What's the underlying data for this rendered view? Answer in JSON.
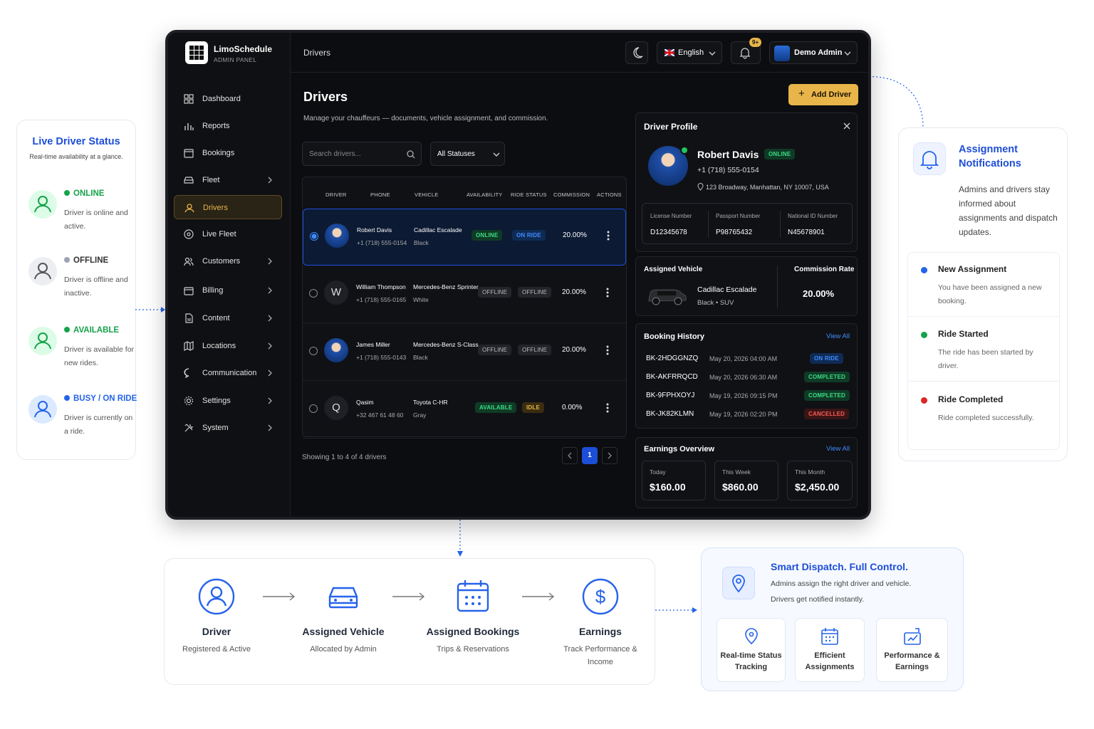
{
  "live_status": {
    "title": "Live Driver Status",
    "subtitle": "Real-time availability at a glance.",
    "items": [
      {
        "label": "ONLINE",
        "desc": "Driver is online and active.",
        "color": "#16a34a"
      },
      {
        "label": "OFFLINE",
        "desc": "Driver is offline and inactive.",
        "color": "#9ca3af"
      },
      {
        "label": "AVAILABLE",
        "desc": "Driver is available for new rides.",
        "color": "#16a34a"
      },
      {
        "label": "BUSY / ON RIDE",
        "desc": "Driver is currently on a ride.",
        "color": "#2563eb"
      }
    ]
  },
  "app": {
    "name": "LimoSchedule",
    "subtitle": "ADMIN PANEL",
    "breadcrumb": "Drivers",
    "language": "English",
    "notif_badge": "9+",
    "user": "Demo Admin"
  },
  "sidebar": {
    "items": [
      {
        "label": "Dashboard",
        "icon": "dashboard-icon"
      },
      {
        "label": "Reports",
        "icon": "reports-icon"
      },
      {
        "label": "Bookings",
        "icon": "calendar-icon"
      },
      {
        "label": "Fleet",
        "icon": "car-icon"
      },
      {
        "label": "Drivers",
        "icon": "driver-icon"
      },
      {
        "label": "Live Fleet",
        "icon": "location-icon"
      },
      {
        "label": "Customers",
        "icon": "users-icon"
      },
      {
        "label": "Billing",
        "icon": "wallet-icon"
      },
      {
        "label": "Content",
        "icon": "document-icon"
      },
      {
        "label": "Locations",
        "icon": "map-icon"
      },
      {
        "label": "Communication",
        "icon": "chat-icon"
      },
      {
        "label": "Settings",
        "icon": "gear-icon"
      },
      {
        "label": "System",
        "icon": "tools-icon"
      }
    ]
  },
  "page": {
    "title": "Drivers",
    "description": "Manage your chauffeurs — documents, vehicle assignment, and commission.",
    "add_button": "Add Driver",
    "search_placeholder": "Search drivers...",
    "status_filter": "All Statuses",
    "showing": "Showing 1 to 4 of 4 drivers",
    "current_page": "1"
  },
  "table": {
    "headers": [
      "DRIVER",
      "PHONE",
      "VEHICLE",
      "AVAILABILITY",
      "RIDE STATUS",
      "COMMISSION",
      "ACTIONS"
    ],
    "rows": [
      {
        "name": "Robert Davis",
        "phone": "+1 (718) 555-0154",
        "vehicle": "Cadillac Escalade",
        "color": "Black",
        "availability": "ONLINE",
        "ride_status": "ON RIDE",
        "commission": "20.00%",
        "initial": ""
      },
      {
        "name": "William Thompson",
        "phone": "+1 (718) 555-0165",
        "vehicle": "Mercedes-Benz Sprinter",
        "color": "White",
        "availability": "OFFLINE",
        "ride_status": "OFFLINE",
        "commission": "20.00%",
        "initial": "W"
      },
      {
        "name": "James Miller",
        "phone": "+1 (718) 555-0143",
        "vehicle": "Mercedes-Benz S-Class",
        "color": "Black",
        "availability": "OFFLINE",
        "ride_status": "OFFLINE",
        "commission": "20.00%",
        "initial": ""
      },
      {
        "name": "Qasim",
        "phone": "+32 467 61 48 60",
        "vehicle": "Toyota C-HR",
        "color": "Gray",
        "availability": "AVAILABLE",
        "ride_status": "IDLE",
        "commission": "0.00%",
        "initial": "Q"
      }
    ]
  },
  "profile": {
    "title": "Driver Profile",
    "name": "Robert Davis",
    "status": "ONLINE",
    "phone": "+1 (718) 555-0154",
    "address": "123 Broadway, Manhattan, NY 10007, USA",
    "docs": [
      {
        "label": "License Number",
        "value": "D12345678"
      },
      {
        "label": "Passport Number",
        "value": "P98765432"
      },
      {
        "label": "National ID Number",
        "value": "N45678901"
      }
    ],
    "vehicle_label": "Assigned Vehicle",
    "vehicle_name": "Cadillac Escalade",
    "vehicle_desc": "Black • SUV",
    "commission_label": "Commission Rate",
    "commission_value": "20.00%",
    "history_title": "Booking History",
    "view_all": "View All",
    "history": [
      {
        "id": "BK-2HDGGNZQ",
        "date": "May 20, 2026 04:00 AM",
        "status": "ON RIDE"
      },
      {
        "id": "BK-AKFRRQCD",
        "date": "May 20, 2026 06:30 AM",
        "status": "COMPLETED"
      },
      {
        "id": "BK-9FPHXOYJ",
        "date": "May 19, 2026 09:15 PM",
        "status": "COMPLETED"
      },
      {
        "id": "BK-JK82KLMN",
        "date": "May 19, 2026 02:20 PM",
        "status": "CANCELLED"
      }
    ],
    "earnings_title": "Earnings Overview",
    "earnings": [
      {
        "label": "Today",
        "value": "$160.00"
      },
      {
        "label": "This Week",
        "value": "$860.00"
      },
      {
        "label": "This Month",
        "value": "$2,450.00"
      }
    ]
  },
  "notifications": {
    "title": "Assignment Notifications",
    "desc": "Admins and drivers stay informed about assignments and dispatch updates.",
    "items": [
      {
        "title": "New Assignment",
        "desc": "You have been assigned a new booking.",
        "color": "#2563eb"
      },
      {
        "title": "Ride Started",
        "desc": "The ride has been started by driver.",
        "color": "#16a34a"
      },
      {
        "title": "Ride Completed",
        "desc": "Ride completed successfully.",
        "color": "#dc2626"
      }
    ]
  },
  "flow": [
    {
      "title": "Driver",
      "desc": "Registered & Active",
      "icon": "user-icon"
    },
    {
      "title": "Assigned Vehicle",
      "desc": "Allocated by Admin",
      "icon": "car-icon"
    },
    {
      "title": "Assigned Bookings",
      "desc": "Trips & Reservations",
      "icon": "calendar-icon"
    },
    {
      "title": "Earnings",
      "desc": "Track Performance & Income",
      "icon": "dollar-icon"
    }
  ],
  "dispatch": {
    "title": "Smart Dispatch. Full Control.",
    "line1": "Admins assign the right driver and vehicle.",
    "line2": "Drivers get notified instantly.",
    "cards": [
      {
        "label": "Real-time Status Tracking",
        "icon": "location-icon"
      },
      {
        "label": "Efficient Assignments",
        "icon": "calendar-icon"
      },
      {
        "label": "Performance & Earnings",
        "icon": "chart-icon"
      }
    ]
  }
}
